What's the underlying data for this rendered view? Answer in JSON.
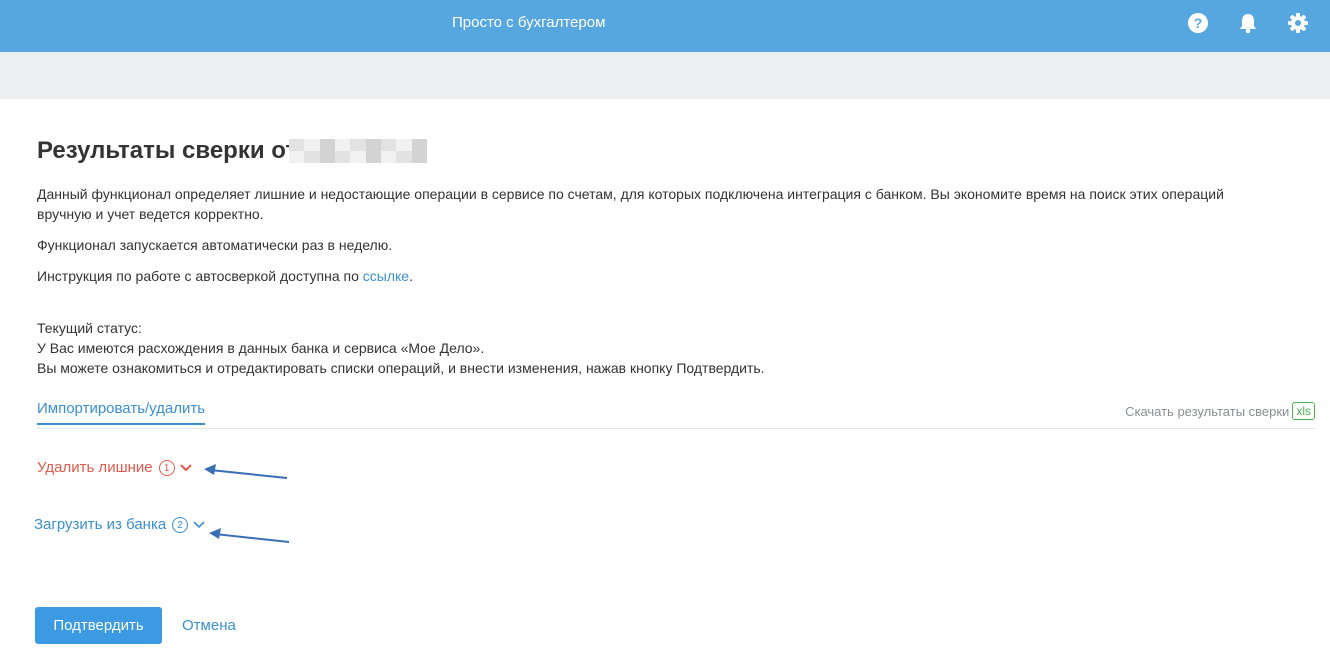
{
  "header": {
    "brand": "Просто с бухгалтером",
    "icons": [
      "help-icon",
      "bell-icon",
      "gear-icon"
    ]
  },
  "page": {
    "title": "Результаты сверки от",
    "description_1": "Данный функционал определяет лишние и недостающие операции в сервисе по счетам, для которых подключена интеграция с банком. Вы экономите время на поиск этих операций вручную и учет ведется корректно.",
    "description_2": "Функционал запускается автоматически раз в неделю.",
    "instruction_prefix": "Инструкция по работе с автосверкой доступна по ",
    "instruction_link": "ссылке",
    "instruction_suffix": ".",
    "status_label": "Текущий статус:",
    "status_line_1": "У Вас имеются расхождения в данных банка и сервиса «Мое Дело».",
    "status_line_2": "Вы можете ознакомиться и отредактировать списки операций, и внести изменения, нажав кнопку Подтвердить."
  },
  "tabs": {
    "active": "Импортировать/удалить",
    "download_label": "Скачать результаты сверки",
    "download_badge": "xls"
  },
  "sections": [
    {
      "label": "Удалить лишние",
      "count": "1",
      "color": "#e25a4b"
    },
    {
      "label": "Загрузить из банка",
      "count": "2",
      "color": "#3b8fd3"
    }
  ],
  "actions": {
    "confirm": "Подтвердить",
    "cancel": "Отмена"
  },
  "colors": {
    "header_bg": "#56a7e0",
    "accent": "#3b8fd3",
    "danger": "#e25a4b",
    "success": "#4caf50",
    "arrow": "#3a6fb6"
  }
}
